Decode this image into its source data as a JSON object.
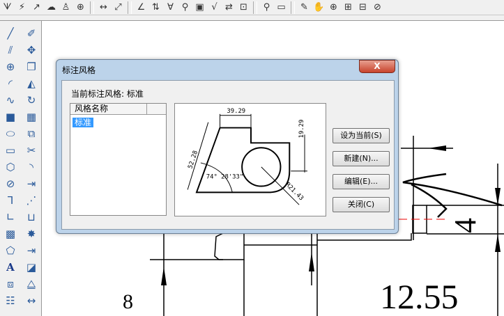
{
  "toolbar": {
    "icons": [
      "spline-icon",
      "zigzag-icon",
      "arrow-icon",
      "cloud-icon",
      "user-symbol-icon",
      "insert-icon",
      "|",
      "linear-dim-icon",
      "aligned-dim-icon",
      "|",
      "angle-dim-icon",
      "baseline-dim-icon",
      "datum-icon",
      "weld-symbol-icon",
      "tolerance-icon",
      "roughness-icon",
      "text-align-icon",
      "zoom-window-icon",
      "|",
      "query-icon",
      "measure-icon",
      "|",
      "pencil-icon",
      "pan-icon",
      "zoom-in-icon",
      "zoom-extents-icon",
      "zoom-previous-icon",
      "zoom-realtime-icon"
    ]
  },
  "left_toolbar": {
    "icons": [
      "line-icon",
      "eraser-icon",
      "parallel-line-icon",
      "move-icon",
      "circle-icon",
      "copy-icon",
      "arc-icon",
      "mirror-icon",
      "spline-curve-icon",
      "rotate-icon",
      "point-icon",
      "array-icon",
      "ellipse-icon",
      "scale-icon",
      "rectangle-icon",
      "trim-icon",
      "polygon-icon",
      "fillet-icon",
      "hatch-shape-icon",
      "extend-icon",
      "polyline-icon",
      "break-icon",
      "centerline-icon",
      "stretch-icon",
      "hatch-icon",
      "explode-icon",
      "outline-icon",
      "align-icon",
      "text-icon",
      "block-icon",
      "layer-icon",
      "layer-state-icon",
      "properties-icon",
      "dimension-icon"
    ]
  },
  "dialog": {
    "title": "标注风格",
    "close_label": "X",
    "current_style_label": "当前标注风格:  标准",
    "list_header": "风格名称",
    "styles": [
      "标准"
    ],
    "preview": {
      "dim_top": "39.29",
      "dim_right": "19.29",
      "dim_left": "52.28",
      "dim_angle": "74° 28'33\"",
      "dim_radius": "R21.43"
    },
    "buttons": {
      "set_current": "设为当前(S)",
      "new": "新建(N)...",
      "edit": "编辑(E)...",
      "close": "关闭(C)"
    }
  },
  "drawing": {
    "dim_value_1": "12.55",
    "dim_value_2": "4",
    "dim_value_3": "8"
  }
}
